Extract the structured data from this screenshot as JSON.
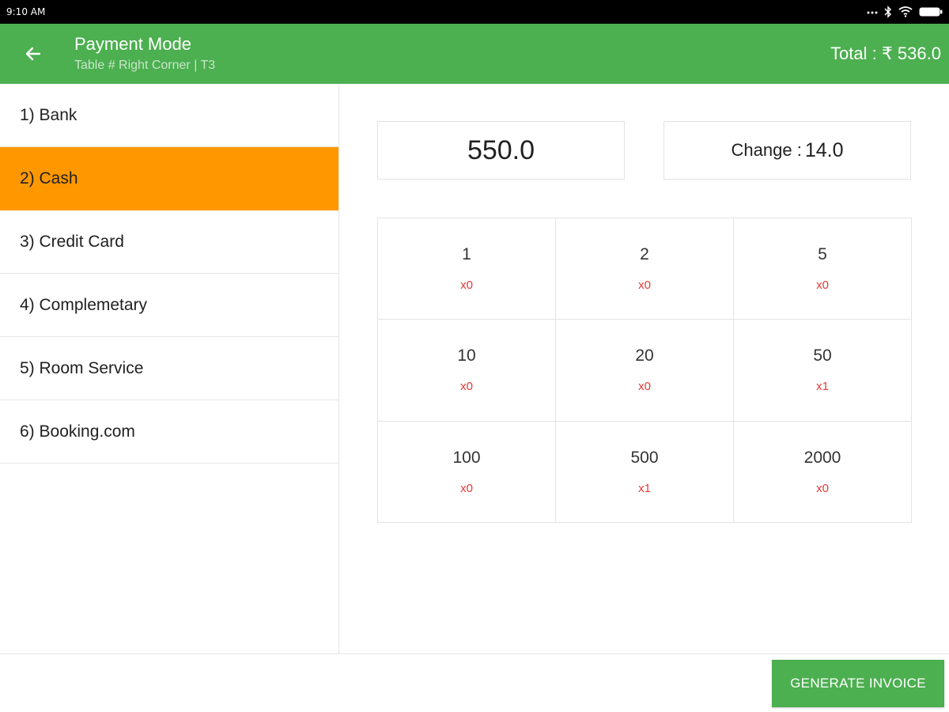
{
  "status_bar": {
    "time": "9:10 AM",
    "icons": [
      "more-dots-icon",
      "bluetooth-icon",
      "wifi-icon",
      "battery-icon"
    ]
  },
  "app_bar": {
    "back_icon": "arrow-left-icon",
    "title": "Payment Mode",
    "subtitle": "Table # Right Corner | T3",
    "total": "Total : ₹ 536.0"
  },
  "payment_modes": [
    {
      "label": "1) Bank",
      "active": false
    },
    {
      "label": "2) Cash",
      "active": true
    },
    {
      "label": "3) Credit Card",
      "active": false
    },
    {
      "label": "4) Complemetary",
      "active": false
    },
    {
      "label": "5) Room Service",
      "active": false
    },
    {
      "label": "6) Booking.com",
      "active": false
    }
  ],
  "amount": {
    "tendered": "550.0",
    "change_label": "Change :",
    "change_value": "14.0"
  },
  "denominations": [
    {
      "value": "1",
      "count": "x0"
    },
    {
      "value": "2",
      "count": "x0"
    },
    {
      "value": "5",
      "count": "x0"
    },
    {
      "value": "10",
      "count": "x0"
    },
    {
      "value": "20",
      "count": "x0"
    },
    {
      "value": "50",
      "count": "x1"
    },
    {
      "value": "100",
      "count": "x0"
    },
    {
      "value": "500",
      "count": "x1"
    },
    {
      "value": "2000",
      "count": "x0"
    }
  ],
  "footer": {
    "generate_label": "GENERATE INVOICE"
  },
  "colors": {
    "primary": "#4caf50",
    "active_mode": "#ff9800",
    "count_text": "#e53935"
  }
}
